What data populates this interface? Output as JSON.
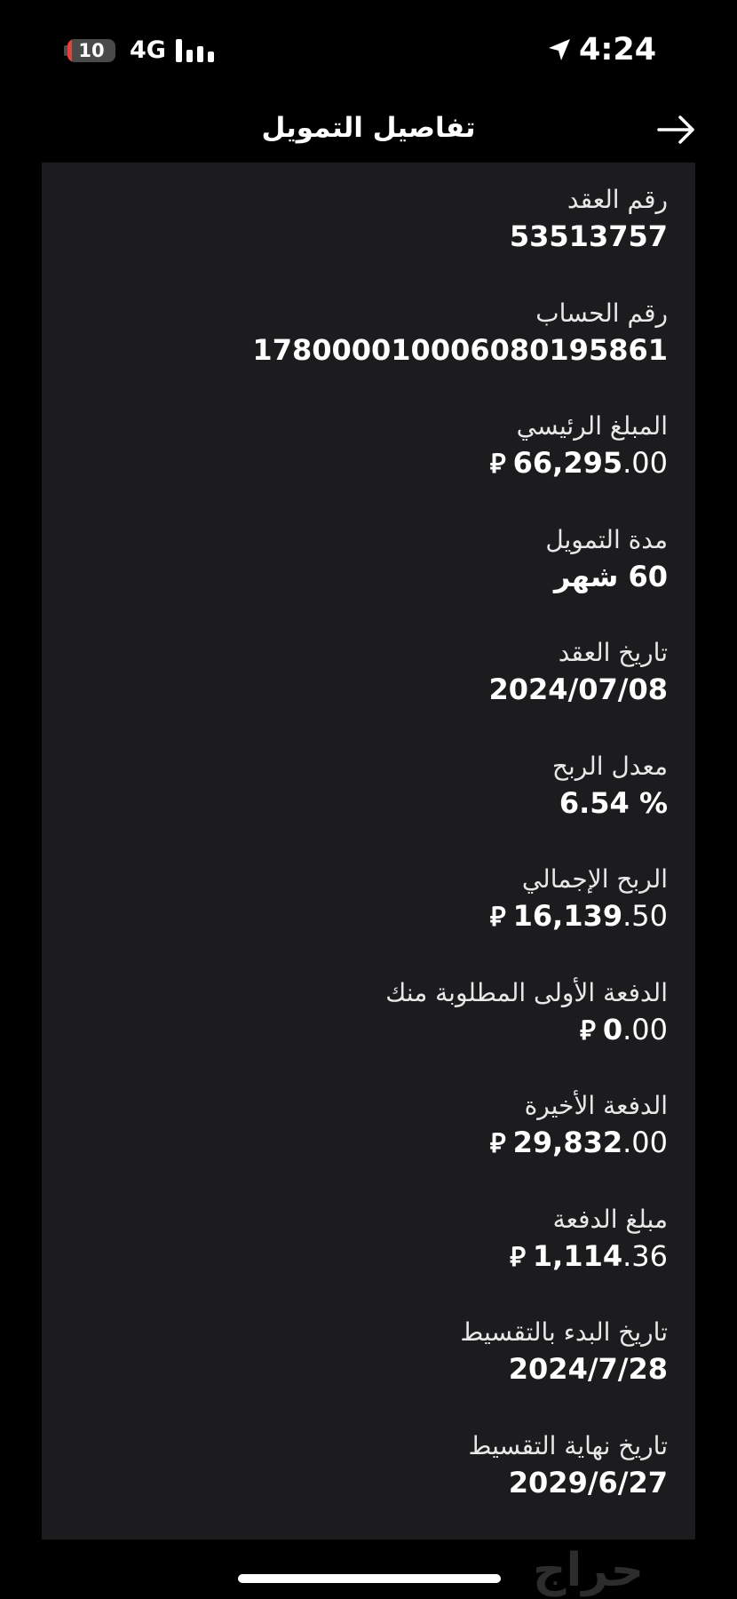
{
  "status_bar": {
    "battery_level": "10",
    "battery_fraction": 0.1,
    "battery_color": "#e5403a",
    "network": "4G",
    "time": "4:24",
    "icons": [
      "battery-icon",
      "signal-bars-icon",
      "location-arrow-icon"
    ]
  },
  "header": {
    "title": "تفاصيل التمويل",
    "back_icon": "arrow-right-icon"
  },
  "details": [
    {
      "label": "رقم العقد",
      "value": "53513757"
    },
    {
      "label": "رقم الحساب",
      "value": "17800001000608019 5861"
    },
    {
      "label": "المبلغ الرئيسي",
      "int": "66,295",
      "dec": ".00",
      "currency": true
    },
    {
      "label": "مدة التمويل",
      "value": "60 شهر"
    },
    {
      "label": "تاريخ العقد",
      "value": "2024/07/08"
    },
    {
      "label": "معدل الربح",
      "value": "6.54 %"
    },
    {
      "label": "الربح الإجمالي",
      "int": "16,139",
      "dec": ".50",
      "currency": true
    },
    {
      "label": "الدفعة الأولى المطلوبة منك",
      "int": "0",
      "dec": ".00",
      "currency": true
    },
    {
      "label": "الدفعة الأخيرة",
      "int": "29,832",
      "dec": ".00",
      "currency": true
    },
    {
      "label": "مبلغ الدفعة",
      "int": "1,114",
      "dec": ".36",
      "currency": true
    },
    {
      "label": "تاريخ البدء بالتقسيط",
      "value": "2024/7/28"
    },
    {
      "label": "تاريخ نهاية التقسيط",
      "value": "2029/6/27"
    }
  ],
  "currency_symbol": "⃁",
  "watermark": "حراج",
  "colors": {
    "background": "#000000",
    "card": "#1c1c1e",
    "text": "#ffffff"
  }
}
